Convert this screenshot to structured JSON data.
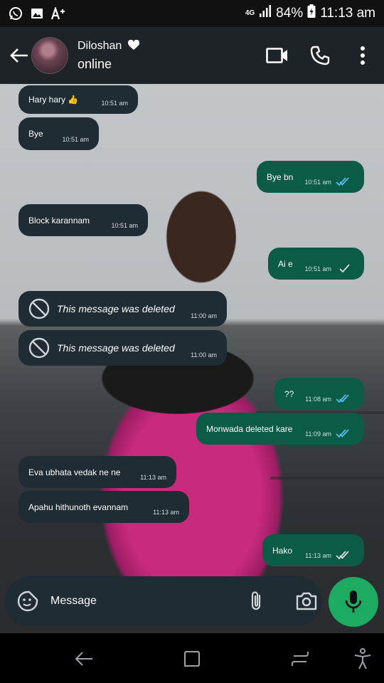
{
  "status_bar": {
    "network": "4G",
    "battery": "84%",
    "time": "11:13 am",
    "icons": [
      "whatsapp-icon",
      "image-icon",
      "font-size-icon",
      "signal-icon",
      "battery-icon"
    ]
  },
  "header": {
    "contact_name": "Diloshan",
    "name_suffix_icon": "heart-icon",
    "status": "online",
    "actions": [
      "video-call-icon",
      "phone-icon",
      "more-vert-icon"
    ]
  },
  "messages": [
    {
      "direction": "in",
      "text": "Hary hary 👍",
      "time": "10:51 am"
    },
    {
      "direction": "in",
      "text": "Bye",
      "time": "10:51 am"
    },
    {
      "direction": "out",
      "text": "Bye bn",
      "time": "10:51 am",
      "status": "read"
    },
    {
      "direction": "in",
      "text": "Block karannam",
      "time": "10:51 am"
    },
    {
      "direction": "out",
      "text": "Ai e",
      "time": "10:51 am",
      "status": "sent"
    },
    {
      "direction": "in",
      "text": "This message was deleted",
      "time": "11:00 am",
      "deleted": true
    },
    {
      "direction": "in",
      "text": "This message was deleted",
      "time": "11:00 am",
      "deleted": true
    },
    {
      "direction": "out",
      "text": "??",
      "time": "11:08 am",
      "status": "read"
    },
    {
      "direction": "out",
      "text": "Monwada deleted kare",
      "time": "11:09 am",
      "status": "read"
    },
    {
      "direction": "in",
      "text": "Eva ubhata vedak ne ne",
      "time": "11:13 am"
    },
    {
      "direction": "in",
      "text": "Apahu hithunoth evannam",
      "time": "11:13 am"
    },
    {
      "direction": "out",
      "text": "Hako",
      "time": "11:13 am",
      "status": "delivered"
    }
  ],
  "composer": {
    "placeholder": "Message",
    "icons": [
      "sticker-icon",
      "attach-icon",
      "camera-icon",
      "mic-icon"
    ]
  },
  "nav_bar": {
    "icons": [
      "back-nav-icon",
      "home-nav-icon",
      "recents-nav-icon",
      "accessibility-icon"
    ]
  },
  "colors": {
    "incoming_bubble": "#1f2c33",
    "outgoing_bubble": "#0b5c46",
    "read_tick": "#53bdeb",
    "accent_green": "#1daa61",
    "header_bg": "#1e2327"
  }
}
